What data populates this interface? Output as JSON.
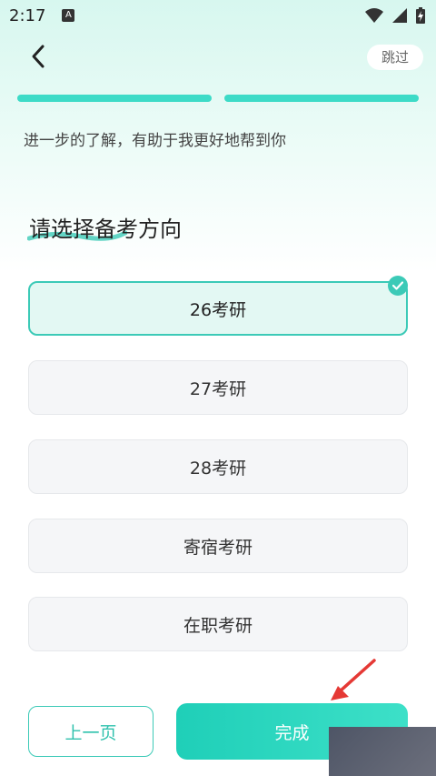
{
  "status_bar": {
    "time": "2:17",
    "notification_letter": "A"
  },
  "header": {
    "skip_label": "跳过"
  },
  "progress": {
    "steps": 2,
    "completed": 2
  },
  "subtitle": "进一步的了解，有助于我更好地帮到你",
  "question": "请选择备考方向",
  "options": [
    {
      "label": "26考研",
      "selected": true
    },
    {
      "label": "27考研",
      "selected": false
    },
    {
      "label": "28考研",
      "selected": false
    },
    {
      "label": "寄宿考研",
      "selected": false
    },
    {
      "label": "在职考研",
      "selected": false
    }
  ],
  "footer": {
    "prev_label": "上一页",
    "done_label": "完成"
  },
  "colors": {
    "accent": "#3ccab7",
    "arrow": "#e53935"
  }
}
